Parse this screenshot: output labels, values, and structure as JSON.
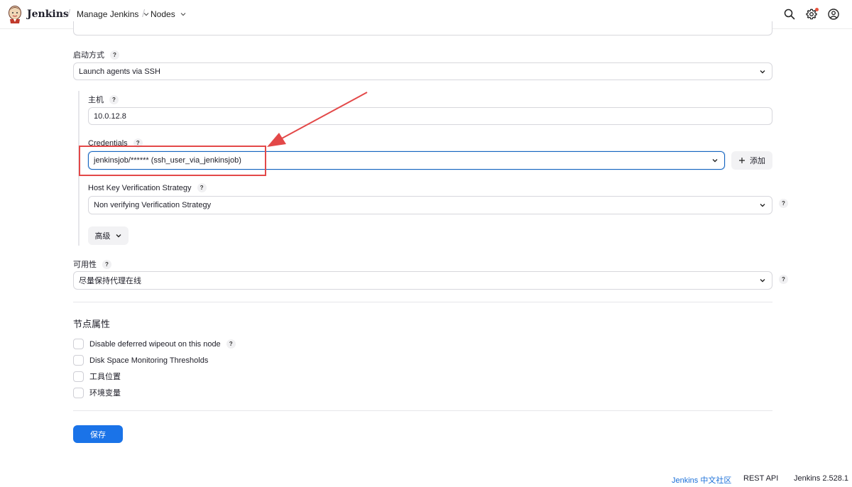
{
  "header": {
    "brand": "Jenkins",
    "breadcrumbs": [
      {
        "label": "Manage Jenkins"
      },
      {
        "label": "Nodes"
      }
    ],
    "icons": [
      "search-icon",
      "gear-icon",
      "user-icon"
    ]
  },
  "form": {
    "launch_method": {
      "label": "启动方式",
      "value": "Launch agents via SSH"
    },
    "host": {
      "label": "主机",
      "value": "10.0.12.8"
    },
    "credentials": {
      "label": "Credentials",
      "value": "jenkinsjob/****** (ssh_user_via_jenkinsjob)",
      "add_label": "添加"
    },
    "host_key": {
      "label": "Host Key Verification Strategy",
      "value": "Non verifying Verification Strategy"
    },
    "advanced_label": "高级",
    "availability": {
      "label": "可用性",
      "value": "尽量保持代理在线"
    },
    "help_mark": "?"
  },
  "node_properties": {
    "title": "节点属性",
    "items": [
      {
        "label": "Disable deferred wipeout on this node",
        "has_help": true
      },
      {
        "label": "Disk Space Monitoring Thresholds"
      },
      {
        "label": "工具位置"
      },
      {
        "label": "环境变量"
      }
    ]
  },
  "save_label": "保存",
  "footer": {
    "community": "Jenkins 中文社区",
    "rest_api": "REST API",
    "version": "Jenkins 2.528.1"
  },
  "colors": {
    "primary": "#1a73e8",
    "annotation": "#e34848",
    "focus_border": "#1565c0"
  }
}
